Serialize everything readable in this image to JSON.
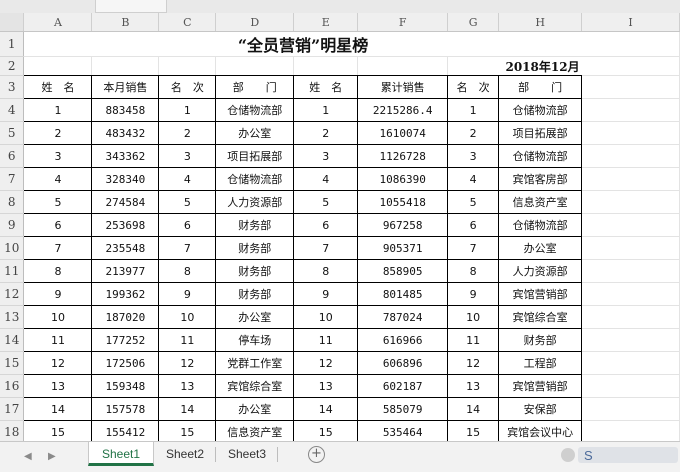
{
  "columns": [
    "A",
    "B",
    "C",
    "D",
    "E",
    "F",
    "G",
    "H",
    "I"
  ],
  "row_numbers": [
    "1",
    "2",
    "3",
    "4",
    "5",
    "6",
    "7",
    "8",
    "9",
    "10",
    "11",
    "12",
    "13",
    "14",
    "15",
    "16",
    "17",
    "18"
  ],
  "title": "“全员营销”明星榜",
  "date": "2018年12月",
  "headers": [
    "姓　名",
    "本月销售",
    "名　次",
    "部　　门",
    "姓　名",
    "累计销售",
    "名　次",
    "部　　门"
  ],
  "rows": [
    [
      "1",
      "883458",
      "1",
      "仓储物流部",
      "1",
      "2215286.4",
      "1",
      "仓储物流部"
    ],
    [
      "2",
      "483432",
      "2",
      "办公室",
      "2",
      "1610074",
      "2",
      "项目拓展部"
    ],
    [
      "3",
      "343362",
      "3",
      "项目拓展部",
      "3",
      "1126728",
      "3",
      "仓储物流部"
    ],
    [
      "4",
      "328340",
      "4",
      "仓储物流部",
      "4",
      "1086390",
      "4",
      "宾馆客房部"
    ],
    [
      "5",
      "274584",
      "5",
      "人力资源部",
      "5",
      "1055418",
      "5",
      "信息资产室"
    ],
    [
      "6",
      "253698",
      "6",
      "财务部",
      "6",
      "967258",
      "6",
      "仓储物流部"
    ],
    [
      "7",
      "235548",
      "7",
      "财务部",
      "7",
      "905371",
      "7",
      "办公室"
    ],
    [
      "8",
      "213977",
      "8",
      "财务部",
      "8",
      "858905",
      "8",
      "人力资源部"
    ],
    [
      "9",
      "199362",
      "9",
      "财务部",
      "9",
      "801485",
      "9",
      "宾馆营销部"
    ],
    [
      "10",
      "187020",
      "10",
      "办公室",
      "10",
      "787024",
      "10",
      "宾馆综合室"
    ],
    [
      "11",
      "177252",
      "11",
      "停车场",
      "11",
      "616966",
      "11",
      "财务部"
    ],
    [
      "12",
      "172506",
      "12",
      "党群工作室",
      "12",
      "606896",
      "12",
      "工程部"
    ],
    [
      "13",
      "159348",
      "13",
      "宾馆综合室",
      "13",
      "602187",
      "13",
      "宾馆营销部"
    ],
    [
      "14",
      "157578",
      "14",
      "办公室",
      "14",
      "585079",
      "14",
      "安保部"
    ],
    [
      "15",
      "155412",
      "15",
      "信息资产室",
      "15",
      "535464",
      "15",
      "宾馆会议中心"
    ]
  ],
  "sheet_tabs": [
    "Sheet1",
    "Sheet2",
    "Sheet3"
  ],
  "active_sheet": "Sheet1",
  "add_sheet_symbol": "+",
  "nav": {
    "prev": "◀",
    "next": "▶"
  },
  "watermark_text": "S",
  "colors": {
    "accent": "#217346",
    "header_bg": "#efefef",
    "grid_line": "#e3e3e3"
  }
}
